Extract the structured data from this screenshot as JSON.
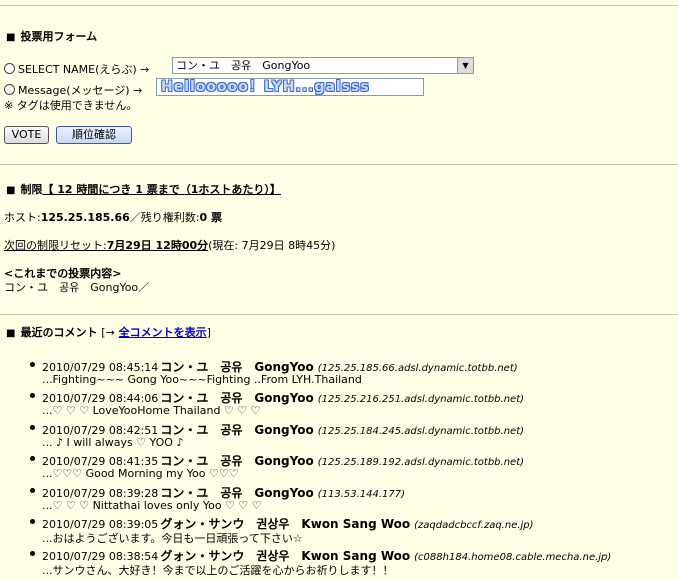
{
  "vote_form": {
    "title": "投票用フォーム",
    "select_label": "SELECT NAME(えらぶ) →",
    "select_value": "コン・ユ　공유　GongYoo",
    "message_label": "Message(メッセージ) →",
    "message_value": "Hellooooo！LYH...galsss",
    "tag_note": "※ タグは使用できません。",
    "vote_button": "VOTE",
    "rank_button": "順位確認"
  },
  "limit": {
    "title_prefix": "制限",
    "title_link": "【 12 時間につき 1 票まで（1ホストあたり）】",
    "host_label": "ホスト:",
    "host_value": "125.25.185.66",
    "remaining_label": "／残り権利数:",
    "remaining_value": "0 票",
    "reset_label": "次回の制限リセット:",
    "reset_value": "7月29日 12時00分",
    "now_text": "(現在: 7月29日 8時45分)",
    "history_title": "<これまでの投票内容>",
    "history_value": "コン・ユ　공유　GongYoo／"
  },
  "recent": {
    "title": "最近のコメント",
    "bracket_open": "[→",
    "link_text": "全コメントを表示",
    "bracket_close": "]",
    "comments": [
      {
        "time": "2010/07/29 08:45:14",
        "name": "コン・ユ　공유　GongYoo",
        "host": "(125.25.185.66.adsl.dynamic.totbb.net)",
        "text": "...Fighting~~~ Gong Yoo~~~Fighting ..From LYH.Thailand"
      },
      {
        "time": "2010/07/29 08:44:06",
        "name": "コン・ユ　공유　GongYoo",
        "host": "(125.25.216.251.adsl.dynamic.totbb.net)",
        "text": "...♡ ♡ ♡ LoveYooHome Thailand ♡ ♡ ♡"
      },
      {
        "time": "2010/07/29 08:42:51",
        "name": "コン・ユ　공유　GongYoo",
        "host": "(125.25.184.245.adsl.dynamic.totbb.net)",
        "text": "... ♪ I will always ♡ YOO ♪"
      },
      {
        "time": "2010/07/29 08:41:35",
        "name": "コン・ユ　공유　GongYoo",
        "host": "(125.25.189.192.adsl.dynamic.totbb.net)",
        "text": "...♡♡♡ Good Morning my Yoo ♡♡♡"
      },
      {
        "time": "2010/07/29 08:39:28",
        "name": "コン・ユ　공유　GongYoo",
        "host": "(113.53.144.177)",
        "text": "...♡ ♡ ♡ Nittathai loves only Yoo ♡ ♡ ♡"
      },
      {
        "time": "2010/07/29 08:39:05",
        "name": "グォン・サンウ　권상우　Kwon Sang Woo",
        "host": "(zaqdadcbccf.zaq.ne.jp)",
        "text": "...おはようございます。今日も一日頑張って下さい☆"
      },
      {
        "time": "2010/07/29 08:38:54",
        "name": "グォン・サンウ　권상우　Kwon Sang Woo",
        "host": "(c088h184.home08.cable.mecha.ne.jp)",
        "text": "...サンウさん、大好き！今まで以上のご活躍を心からお祈りします！！"
      }
    ]
  }
}
